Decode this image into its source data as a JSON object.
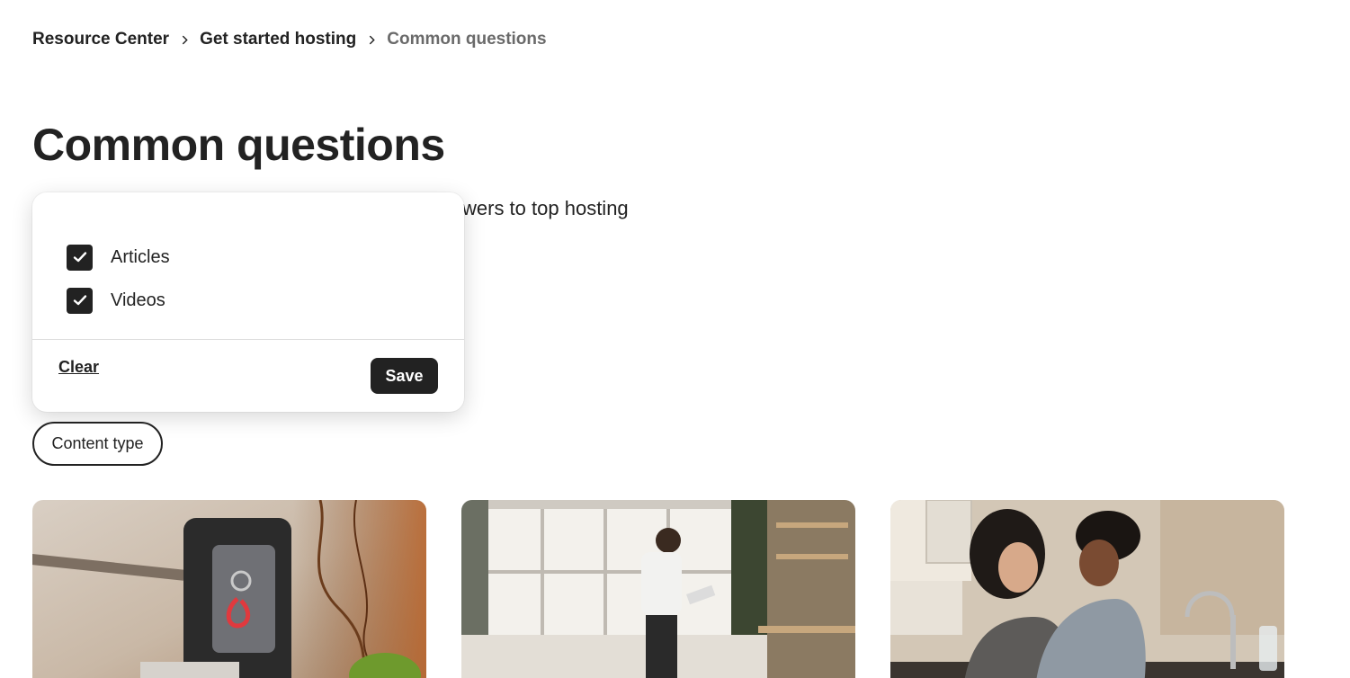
{
  "breadcrumb": {
    "items": [
      "Resource Center",
      "Get started hosting",
      "Common questions"
    ]
  },
  "page": {
    "title": "Common questions",
    "subtitle_visible": "wers to top hosting"
  },
  "filter_popover": {
    "options": [
      {
        "label": "Articles",
        "checked": true
      },
      {
        "label": "Videos",
        "checked": true
      }
    ],
    "clear_label": "Clear",
    "save_label": "Save"
  },
  "filter_pill": {
    "label": "Content type"
  },
  "colors": {
    "text": "#222222",
    "muted": "#6a6a6a",
    "divider": "#dddddd",
    "button_bg": "#222222"
  },
  "cards": [
    {
      "image": "lockbox-photo"
    },
    {
      "image": "man-with-tablet-photo"
    },
    {
      "image": "two-women-kitchen-photo"
    }
  ]
}
